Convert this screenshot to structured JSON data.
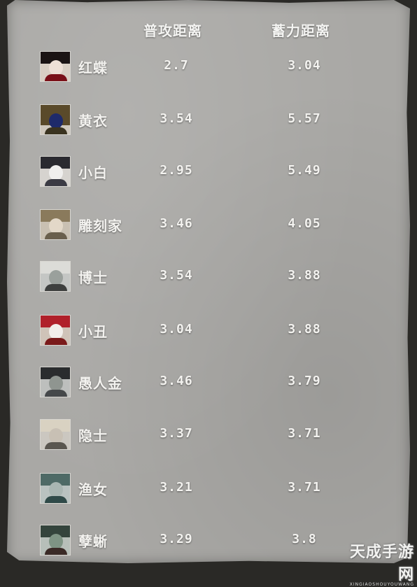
{
  "headers": {
    "attack": "普攻距离",
    "charge": "蓄力距离"
  },
  "rows": [
    {
      "name": "红蝶",
      "attack": "2.7",
      "charge": "3.04",
      "icon": "red-butterfly-portrait-icon"
    },
    {
      "name": "黄衣",
      "attack": "3.54",
      "charge": "5.57",
      "icon": "yellow-robe-portrait-icon"
    },
    {
      "name": "小白",
      "attack": "2.95",
      "charge": "5.49",
      "icon": "little-white-portrait-icon"
    },
    {
      "name": "雕刻家",
      "attack": "3.46",
      "charge": "4.05",
      "icon": "sculptor-portrait-icon"
    },
    {
      "name": "博士",
      "attack": "3.54",
      "charge": "3.88",
      "icon": "doctor-portrait-icon"
    },
    {
      "name": "小丑",
      "attack": "3.04",
      "charge": "3.88",
      "icon": "clown-portrait-icon"
    },
    {
      "name": "愚人金",
      "attack": "3.46",
      "charge": "3.79",
      "icon": "fools-gold-portrait-icon"
    },
    {
      "name": "隐士",
      "attack": "3.37",
      "charge": "3.71",
      "icon": "hermit-portrait-icon"
    },
    {
      "name": "渔女",
      "attack": "3.21",
      "charge": "3.71",
      "icon": "fisher-girl-portrait-icon"
    },
    {
      "name": "孽蜥",
      "attack": "3.29",
      "charge": "3.8",
      "icon": "lizard-portrait-icon"
    }
  ],
  "watermark": {
    "main": "天成手游网",
    "sub": "XINGIAOSHOUYOUWANG"
  }
}
